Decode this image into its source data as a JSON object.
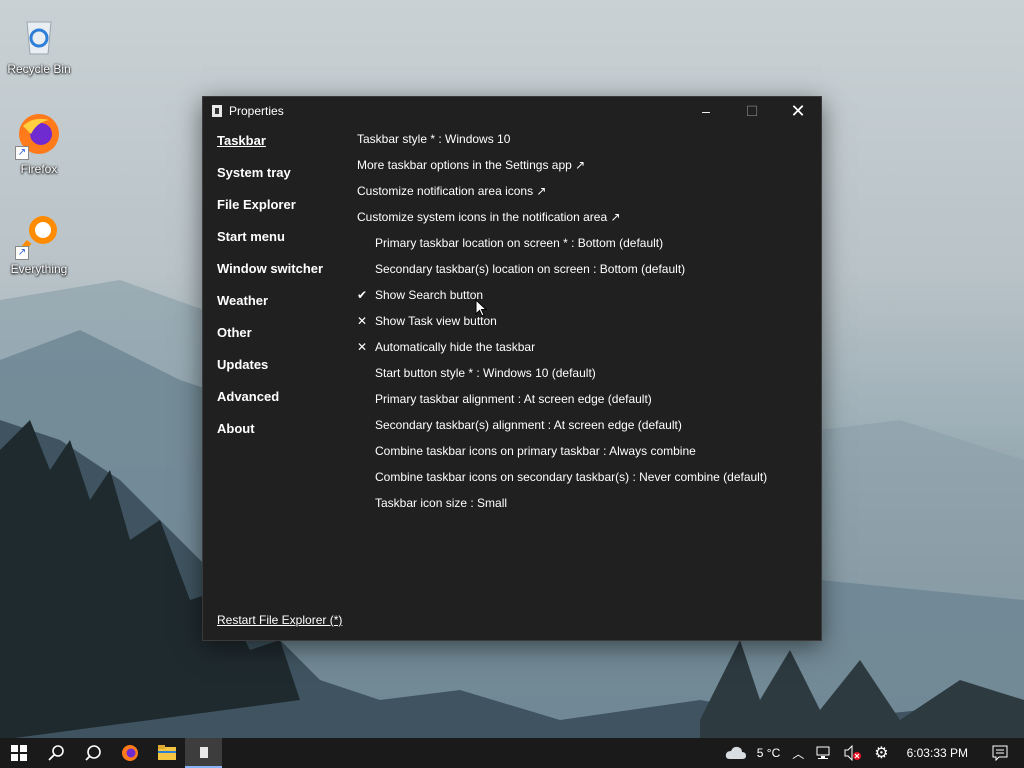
{
  "desktop": {
    "icons": [
      {
        "label": "Recycle Bin",
        "icon": "recycle-bin-icon"
      },
      {
        "label": "Firefox",
        "icon": "firefox-icon"
      },
      {
        "label": "Everything",
        "icon": "everything-search-icon"
      }
    ]
  },
  "window": {
    "title": "Properties",
    "controls": {
      "minimize": "–",
      "maximize": "☐",
      "close": "✕"
    },
    "nav": [
      {
        "label": "Taskbar",
        "active": true
      },
      {
        "label": "System tray"
      },
      {
        "label": "File Explorer"
      },
      {
        "label": "Start menu"
      },
      {
        "label": "Window switcher"
      },
      {
        "label": "Weather"
      },
      {
        "label": "Other"
      },
      {
        "label": "Updates"
      },
      {
        "label": "Advanced"
      },
      {
        "label": "About"
      }
    ],
    "options": [
      {
        "label": "Taskbar style * : Windows 10"
      },
      {
        "label": "More taskbar options in the Settings app ↗"
      },
      {
        "label": "Customize notification area icons ↗"
      },
      {
        "label": "Customize system icons in the notification area ↗"
      },
      {
        "label": "Primary taskbar location on screen * : Bottom (default)"
      },
      {
        "label": "Secondary taskbar(s) location on screen : Bottom (default)"
      },
      {
        "label": "Show Search button",
        "mark": "✔"
      },
      {
        "label": "Show Task view button",
        "mark": "✕"
      },
      {
        "label": "Automatically hide the taskbar",
        "mark": "✕"
      },
      {
        "label": "Start button style * : Windows 10 (default)"
      },
      {
        "label": "Primary taskbar alignment : At screen edge (default)"
      },
      {
        "label": "Secondary taskbar(s) alignment : At screen edge (default)"
      },
      {
        "label": "Combine taskbar icons on primary taskbar : Always combine"
      },
      {
        "label": "Combine taskbar icons on secondary taskbar(s) : Never combine (default)"
      },
      {
        "label": "Taskbar icon size : Small"
      }
    ],
    "restart_link": "Restart File Explorer (*)"
  },
  "taskbar": {
    "buttons": [
      "windows-start-icon",
      "search-icon",
      "search-icon",
      "firefox-icon",
      "file-explorer-icon",
      "properties-app-icon"
    ],
    "weather": "5 °C",
    "clock": "6:03:33 PM"
  }
}
